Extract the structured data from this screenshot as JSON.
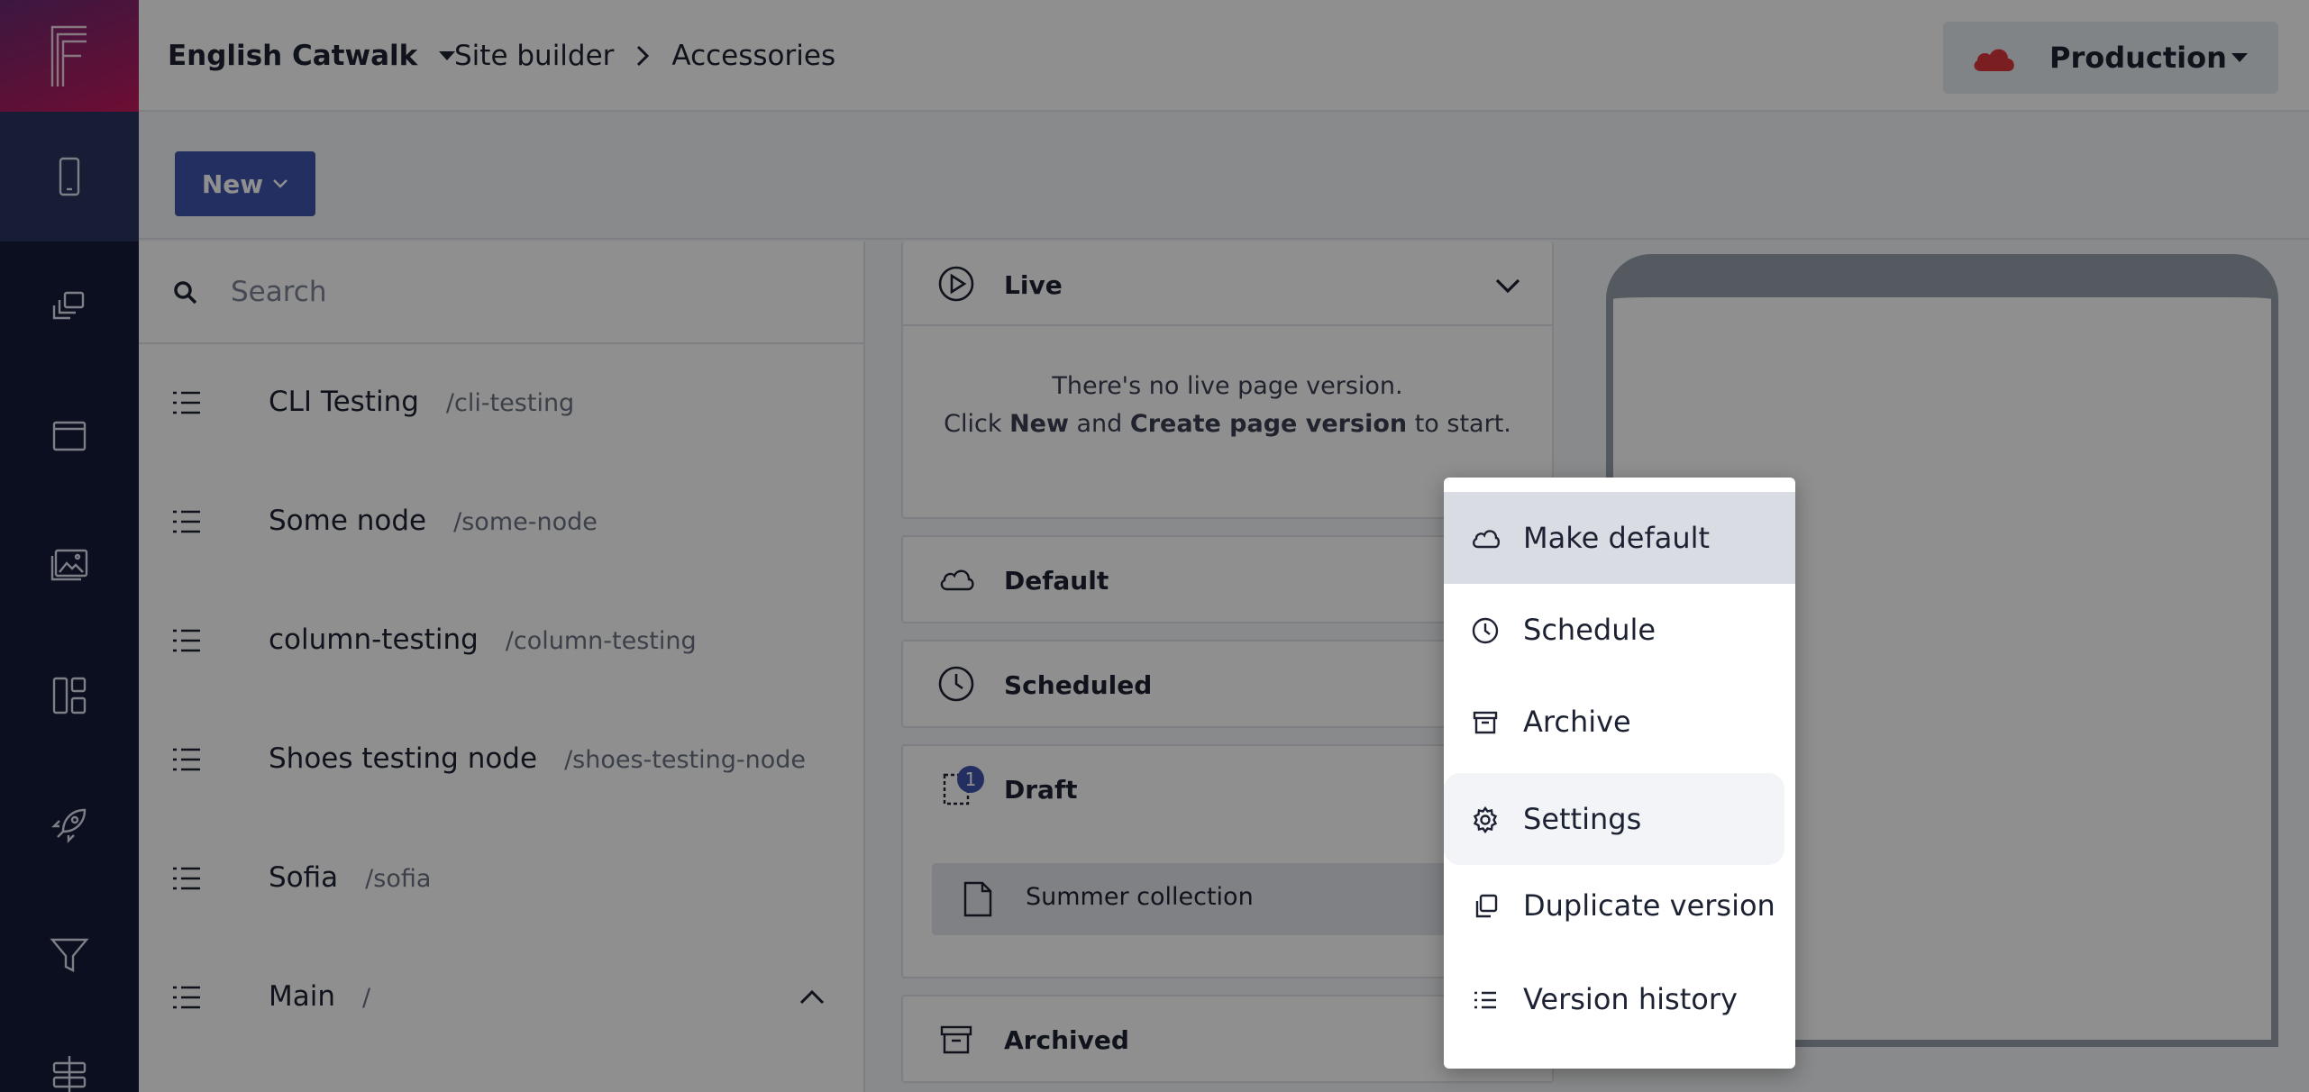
{
  "header": {
    "project": "English Catwalk",
    "breadcrumb": [
      "Site builder",
      "Accessories"
    ],
    "environment": "Production"
  },
  "toolbar": {
    "new_label": "New"
  },
  "tree": {
    "search_placeholder": "Search",
    "nodes": [
      {
        "name": "CLI Testing",
        "path": "/cli-testing"
      },
      {
        "name": "Some node",
        "path": "/some-node"
      },
      {
        "name": "column-testing",
        "path": "/column-testing"
      },
      {
        "name": "Shoes testing node",
        "path": "/shoes-testing-node"
      },
      {
        "name": "Sofia",
        "path": "/sofia"
      },
      {
        "name": "Main",
        "path": "/"
      }
    ]
  },
  "versions": {
    "live": {
      "title": "Live",
      "empty_line1": "There's no live page version.",
      "empty_click": "Click",
      "empty_new": "New",
      "empty_and": "and",
      "empty_create": "Create page version",
      "empty_tail": "to start."
    },
    "default_title": "Default",
    "scheduled_title": "Scheduled",
    "draft": {
      "title": "Draft",
      "badge": "1",
      "item": "Summer collection"
    },
    "archived_title": "Archived"
  },
  "menu": {
    "items": [
      "Make default",
      "Schedule",
      "Archive",
      "Settings",
      "Duplicate version",
      "Version history"
    ]
  },
  "colors": {
    "primary": "#3f54ae",
    "rail": "#141c3a",
    "env_cloud": "#d9363e"
  }
}
